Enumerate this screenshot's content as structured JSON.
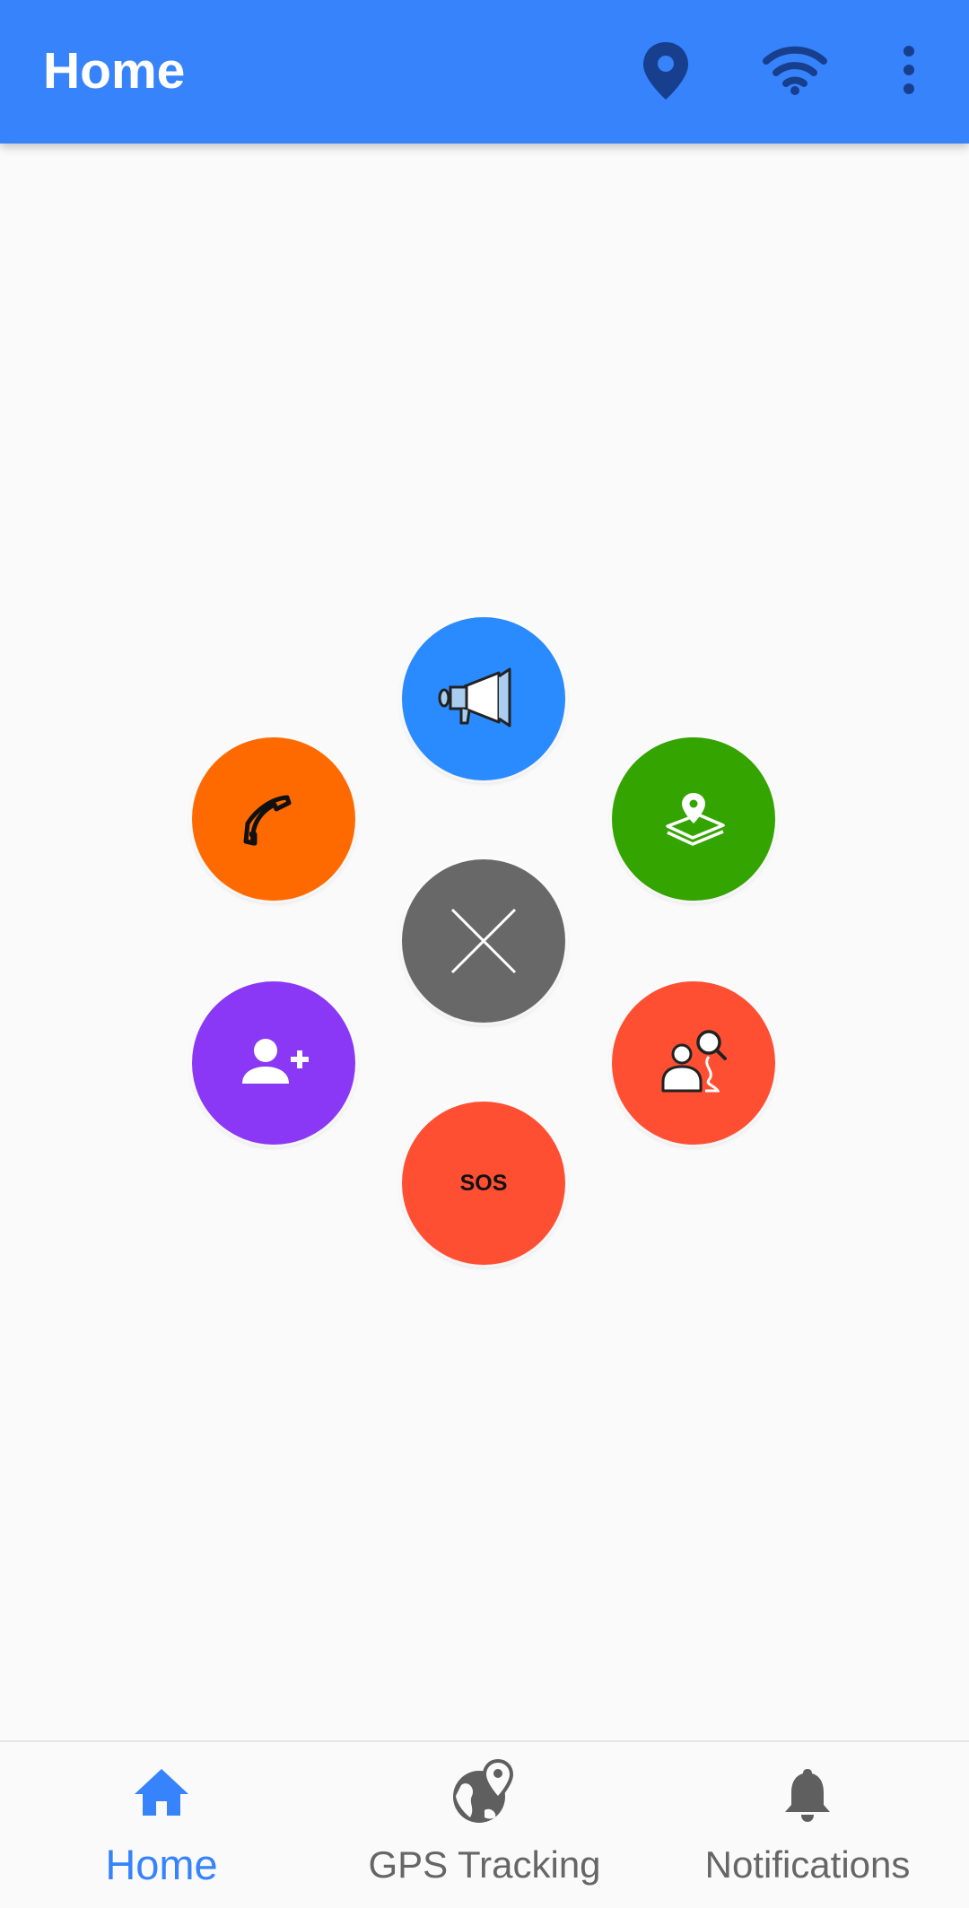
{
  "appbar": {
    "title": "Home",
    "icons": [
      "location-pin-icon",
      "wifi-icon",
      "more-vert-icon"
    ],
    "color": "#3683fc"
  },
  "radial_menu": {
    "items": [
      {
        "name": "announcement-button",
        "icon": "megaphone-icon",
        "color": "#2a8aff"
      },
      {
        "name": "location-share-button",
        "icon": "map-pin-icon",
        "color": "#33a400"
      },
      {
        "name": "track-person-button",
        "icon": "person-search-icon",
        "color": "#ff4f33"
      },
      {
        "name": "sos-button",
        "icon": "sos-icon",
        "color": "#ff4f33",
        "label": "SOS"
      },
      {
        "name": "add-contact-button",
        "icon": "person-add-icon",
        "color": "#8a38f5"
      },
      {
        "name": "call-button",
        "icon": "phone-icon",
        "color": "#ff6a00"
      },
      {
        "name": "close-menu-button",
        "icon": "close-icon",
        "color": "#686868"
      }
    ]
  },
  "bottom_nav": {
    "items": [
      {
        "label": "Home",
        "icon": "home-icon",
        "active": true
      },
      {
        "label": "GPS Tracking",
        "icon": "globe-pin-icon",
        "active": false
      },
      {
        "label": "Notifications",
        "icon": "bell-icon",
        "active": false
      }
    ],
    "active_color": "#3683fc",
    "inactive_color": "#666666"
  }
}
